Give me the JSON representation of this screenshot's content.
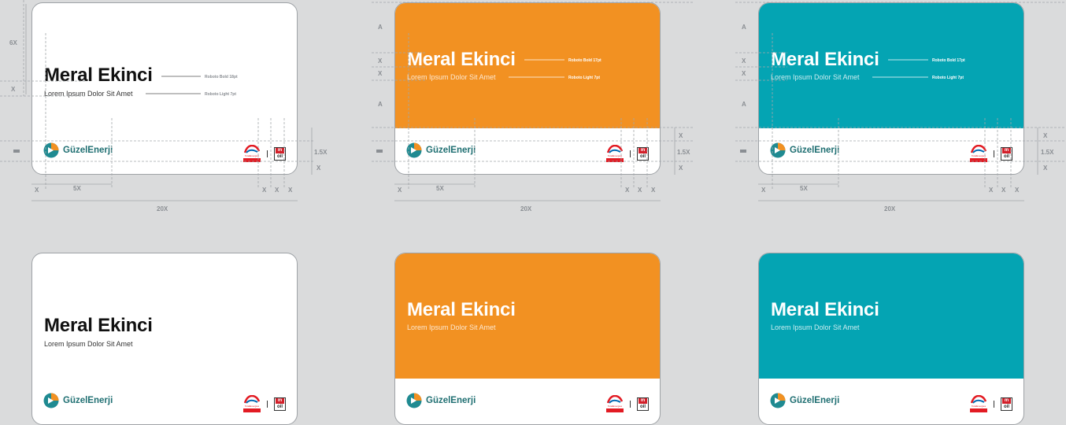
{
  "cards": [
    {
      "id": "w1",
      "variant": "white",
      "name": "Meral Ekinci",
      "subtitle": "Lorem Ipsum Dolor Sit Amet",
      "brand": "GüzelEnerji"
    },
    {
      "id": "o1",
      "variant": "orange",
      "name": "Meral Ekinci",
      "subtitle": "Lorem Ipsum Dolor Sit Amet",
      "brand": "GüzelEnerji"
    },
    {
      "id": "t1",
      "variant": "teal",
      "name": "Meral Ekinci",
      "subtitle": "Lorem Ipsum Dolor Sit Amet",
      "brand": "GüzelEnerji"
    },
    {
      "id": "w2",
      "variant": "white",
      "name": "Meral Ekinci",
      "subtitle": "Lorem Ipsum Dolor Sit Amet",
      "brand": "GüzelEnerji"
    },
    {
      "id": "o2",
      "variant": "orange",
      "name": "Meral Ekinci",
      "subtitle": "Lorem Ipsum Dolor Sit Amet",
      "brand": "GüzelEnerji"
    },
    {
      "id": "t2",
      "variant": "teal",
      "name": "Meral Ekinci",
      "subtitle": "Lorem Ipsum Dolor Sit Amet",
      "brand": "GüzelEnerji"
    }
  ],
  "partners": {
    "totalenergies_text": "TotalEnergies",
    "moil_top": "m",
    "moil_bottom": "oil"
  },
  "specs": {
    "white": {
      "name_font": "Roboto Bold 18pt",
      "sub_font": "Roboto Light 7pt"
    },
    "color": {
      "name_font": "Roboto Bold 17pt",
      "sub_font": "Roboto Light 7pt"
    }
  },
  "guides": {
    "six_x": "6X",
    "x": "X",
    "a": "A",
    "one_five_x": "1.5X",
    "five_x": "5X",
    "twenty_x": "20X"
  },
  "colors": {
    "orange": "#f29122",
    "teal": "#04a4b3",
    "brand_teal": "#1f6f72",
    "logo_orange": "#f29122",
    "red": "#e21b23",
    "background": "#dadbdc"
  }
}
